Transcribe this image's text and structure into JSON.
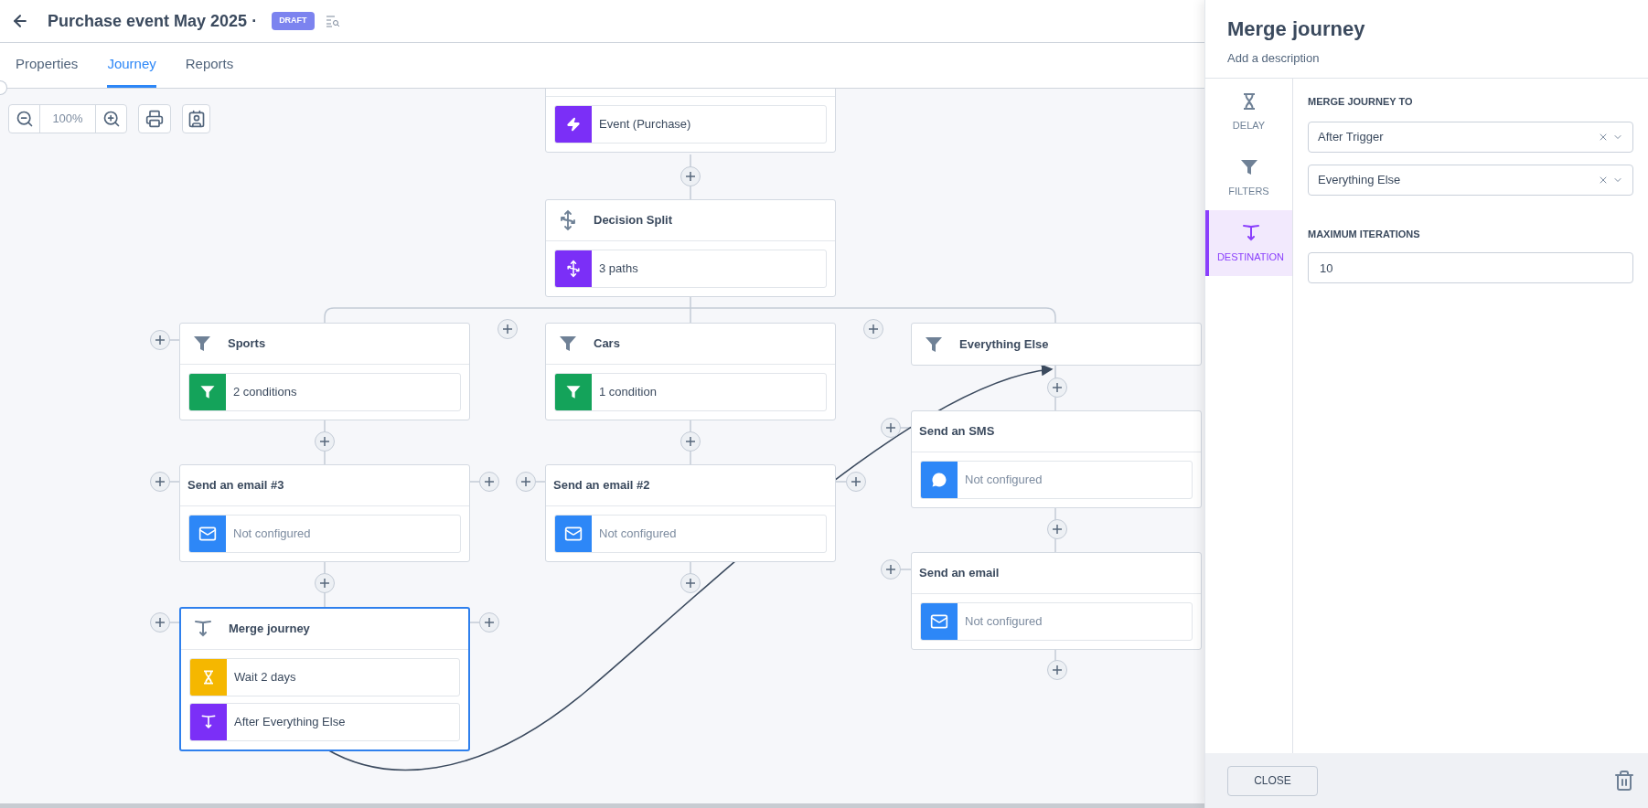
{
  "header": {
    "title": "Purchase event May 2025 ·",
    "badge": "DRAFT"
  },
  "tabs": [
    {
      "label": "Properties",
      "selected": false
    },
    {
      "label": "Journey",
      "selected": true
    },
    {
      "label": "Reports",
      "selected": false
    }
  ],
  "zoom": {
    "level": "100%"
  },
  "nodes": [
    {
      "kind": "trigger",
      "selected": false,
      "rows": [
        {
          "kind": "event",
          "text": "Event (Purchase)",
          "configured": true
        }
      ]
    },
    {
      "kind": "split",
      "title": "Decision Split",
      "selected": false,
      "rows": [
        {
          "kind": "split",
          "text": "3 paths",
          "configured": true
        }
      ]
    },
    {
      "kind": "filter",
      "title": "Sports",
      "selected": false,
      "rows": [
        {
          "kind": "filter",
          "text": "2 conditions",
          "configured": true
        }
      ]
    },
    {
      "kind": "filter",
      "title": "Cars",
      "selected": false,
      "rows": [
        {
          "kind": "filter",
          "text": "1 condition",
          "configured": true
        }
      ]
    },
    {
      "kind": "filter",
      "title": "Everything Else",
      "selected": false
    },
    {
      "kind": "action",
      "title": "Send an email #3",
      "selected": false,
      "rows": [
        {
          "kind": "email",
          "text": "Not configured",
          "configured": false
        }
      ]
    },
    {
      "kind": "action",
      "title": "Send an email #2",
      "selected": false,
      "rows": [
        {
          "kind": "email",
          "text": "Not configured",
          "configured": false
        }
      ]
    },
    {
      "kind": "action",
      "title": "Send an SMS",
      "selected": false,
      "rows": [
        {
          "kind": "sms",
          "text": "Not configured",
          "configured": false
        }
      ]
    },
    {
      "kind": "action",
      "title": "Send an email",
      "selected": false,
      "rows": [
        {
          "kind": "email",
          "text": "Not configured",
          "configured": false
        }
      ]
    },
    {
      "kind": "merge",
      "title": "Merge journey",
      "selected": true,
      "rows": [
        {
          "kind": "delay",
          "text": "Wait 2 days",
          "configured": true
        },
        {
          "kind": "destination",
          "text": "After Everything Else",
          "configured": true
        }
      ]
    }
  ],
  "panel": {
    "title": "Merge journey",
    "description": "Add a description",
    "nav": [
      {
        "kind": "delay",
        "label": "DELAY",
        "selected": false
      },
      {
        "kind": "filter",
        "label": "FILTERS",
        "selected": false
      },
      {
        "kind": "destination",
        "label": "DESTINATION",
        "selected": true
      }
    ],
    "merge_to_label": "MERGE JOURNEY TO",
    "merge_to": [
      {
        "value": "After Trigger"
      },
      {
        "value": "Everything Else"
      }
    ],
    "iterations_label": "MAXIMUM ITERATIONS",
    "iterations_value": "10",
    "close_button": "CLOSE"
  }
}
